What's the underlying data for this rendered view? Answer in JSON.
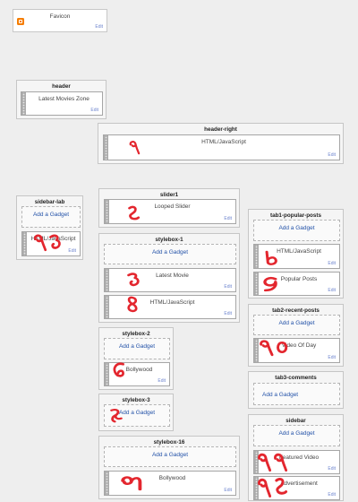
{
  "colors": {
    "canvas": "#eeeeee",
    "link": "#2352a8",
    "edit": "#6f86cf",
    "annotation": "#e3262e",
    "favicon_icon": "#f57d00"
  },
  "favicon": {
    "icon": "blogger-icon",
    "label": "Favicon",
    "edit": "Edit"
  },
  "header": {
    "title": "header",
    "gadgets": [
      {
        "label": "Latest Movies Zone",
        "edit": "Edit"
      }
    ]
  },
  "header_right": {
    "title": "header-right",
    "gadgets": [
      {
        "label": "HTML/JavaScript",
        "edit": "Edit",
        "annotation": "১"
      }
    ]
  },
  "sidebar_lab": {
    "title": "sidebar-lab",
    "add_gadget": "Add a Gadget",
    "gadgets": [
      {
        "label": "HTML/JavaScript",
        "edit": "Edit",
        "annotation": "১৩"
      }
    ]
  },
  "slider1": {
    "title": "slider1",
    "gadgets": [
      {
        "label": "Looped Slider",
        "edit": "Edit",
        "annotation": "২"
      }
    ]
  },
  "stylebox_1": {
    "title": "stylebox-1",
    "add_gadget": "Add a Gadget",
    "gadgets": [
      {
        "label": "Latest Movie",
        "edit": "Edit",
        "annotation": "৩"
      },
      {
        "label": "HTML/JavaScript",
        "edit": "Edit",
        "annotation": "৪"
      }
    ]
  },
  "stylebox_2": {
    "title": "stylebox-2",
    "add_gadget": "Add a Gadget",
    "gadgets": [
      {
        "label": "Bollywood",
        "edit": "Edit",
        "annotation": "৫"
      }
    ]
  },
  "stylebox_3": {
    "title": "stylebox-3",
    "add_gadget": "Add a Gadget",
    "annotation": "৬"
  },
  "stylebox_16": {
    "title": "stylebox-16",
    "add_gadget": "Add a Gadget",
    "gadgets": [
      {
        "label": "Bollywood",
        "edit": "Edit",
        "annotation": "৭"
      }
    ]
  },
  "tab1_popular_posts": {
    "title": "tab1-popular-posts",
    "add_gadget": "Add a Gadget",
    "gadgets": [
      {
        "label": "HTML/JavaScript",
        "edit": "Edit",
        "annotation": "৮"
      },
      {
        "label": "Popular Posts",
        "edit": "Edit",
        "annotation": "৯"
      }
    ]
  },
  "tab2_recent_posts": {
    "title": "tab2-recent-posts",
    "add_gadget": "Add a Gadget",
    "gadgets": [
      {
        "label": "Video Of Day",
        "edit": "Edit",
        "annotation": "১০"
      }
    ]
  },
  "tab3_comments": {
    "title": "tab3-comments",
    "add_gadget": "Add a Gadget"
  },
  "sidebar": {
    "title": "sidebar",
    "add_gadget": "Add a Gadget",
    "gadgets": [
      {
        "label": "Featured Video",
        "edit": "Edit",
        "annotation": "১১"
      },
      {
        "label": "Advertisement",
        "edit": "Edit",
        "annotation": "১২"
      }
    ]
  }
}
